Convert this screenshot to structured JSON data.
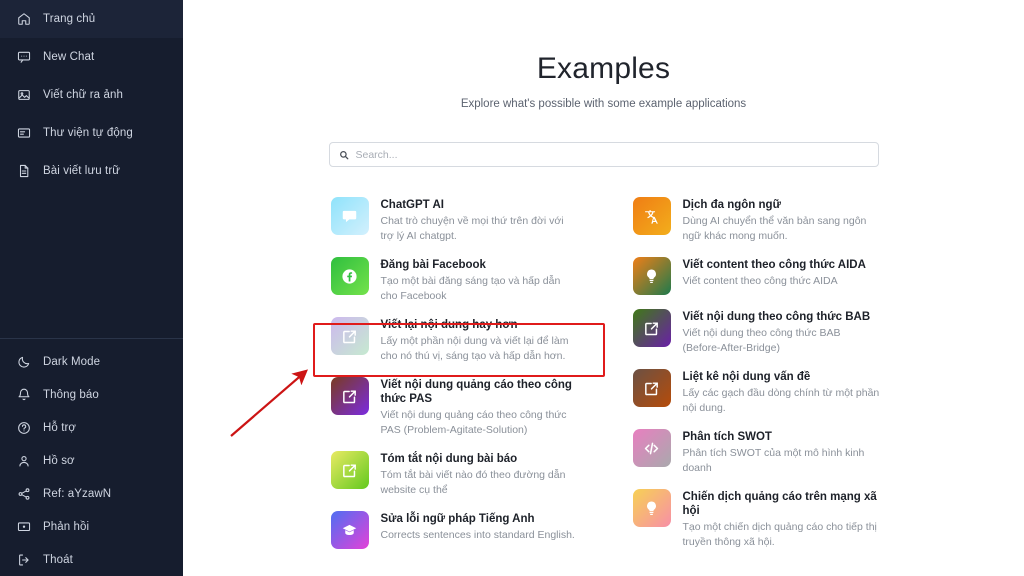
{
  "sidebar": {
    "top_items": [
      {
        "label": "Trang chủ",
        "icon": "home-icon",
        "active": true
      },
      {
        "label": "New Chat",
        "icon": "chat-icon",
        "active": false
      },
      {
        "label": "Viết chữ ra ảnh",
        "icon": "image-icon",
        "active": false
      },
      {
        "label": "Thư viện tự động",
        "icon": "library-icon",
        "active": false
      },
      {
        "label": "Bài viết lưu trữ",
        "icon": "document-icon",
        "active": false
      }
    ],
    "bottom_items": [
      {
        "label": "Dark Mode",
        "icon": "moon-icon"
      },
      {
        "label": "Thông báo",
        "icon": "bell-icon"
      },
      {
        "label": "Hỗ trợ",
        "icon": "question-circle-icon"
      },
      {
        "label": "Hồ sơ",
        "icon": "user-icon"
      },
      {
        "label": "Ref: aYzawN",
        "icon": "share-icon"
      },
      {
        "label": "Phản hồi",
        "icon": "feedback-icon"
      },
      {
        "label": "Thoát",
        "icon": "logout-icon"
      }
    ],
    "background_color": "#161d2e",
    "active_color": "#1f2840"
  },
  "main": {
    "title": "Examples",
    "subtitle": "Explore what's possible with some example applications",
    "search": {
      "placeholder": "Search...",
      "value": "",
      "icon": "search-icon"
    }
  },
  "cards": {
    "left": [
      {
        "title": "ChatGPT AI",
        "desc": "Chat trò chuyện về mọi thứ trên đời với trợ lý AI chatgpt.",
        "icon": "chat-bubble-icon",
        "gradient_from": "#8fe3fb",
        "gradient_to": "#c9ecfb"
      },
      {
        "title": "Đăng bài Facebook",
        "desc": "Tạo một bài đăng sáng tạo và hấp dẫn cho Facebook",
        "icon": "facebook-icon",
        "gradient_from": "#2fbf3f",
        "gradient_to": "#63dd46"
      },
      {
        "title": "Viết lại nội dung hay hơn",
        "desc": "Lấy một phần nội dung và viết lại để làm cho nó thú vị, sáng tạo và hấp dẫn hơn.",
        "icon": "edit-square-icon",
        "gradient_from": "#cdb8ee",
        "gradient_to": "#bfe8cd",
        "highlighted": true
      },
      {
        "title": "Viết nội dung quảng cáo theo công thức PAS",
        "desc": "Viết nội dung quảng cáo theo công thức PAS (Problem-Agitate-Solution)",
        "icon": "edit-square-icon",
        "gradient_from": "#7a3b21",
        "gradient_to": "#7b2ce0"
      },
      {
        "title": "Tóm tắt nội dung bài báo",
        "desc": "Tóm tắt bài viết nào đó theo đường dẫn website cụ thể",
        "icon": "edit-square-icon",
        "gradient_from": "#e9ea63",
        "gradient_to": "#63c91f"
      },
      {
        "title": "Sửa lỗi ngữ pháp Tiếng Anh",
        "desc": "Corrects sentences into standard English.",
        "icon": "graduation-cap-icon",
        "gradient_from": "#4f6ff2",
        "gradient_to": "#e341d8"
      }
    ],
    "right": [
      {
        "title": "Dịch đa ngôn ngữ",
        "desc": "Dùng AI chuyển thể văn bản sang ngôn ngữ khác mong muốn.",
        "icon": "translate-icon",
        "gradient_from": "#f07d14",
        "gradient_to": "#f2a81a"
      },
      {
        "title": "Viết content theo công thức AIDA",
        "desc": "Viết content theo công thức AIDA",
        "icon": "lightbulb-icon",
        "gradient_from": "#ef7f18",
        "gradient_to": "#1f7a4c"
      },
      {
        "title": "Viết nội dung theo công thức BAB",
        "desc": "Viết nội dung theo công thức BAB (Before-After-Bridge)",
        "icon": "edit-square-icon",
        "gradient_from": "#3f7a16",
        "gradient_to": "#6a1fa8"
      },
      {
        "title": "Liệt kê nội dung vấn đề",
        "desc": "Lấy các gạch đầu dòng chính từ một phần nội dung.",
        "icon": "edit-square-icon",
        "gradient_from": "#6b5144",
        "gradient_to": "#b64c0a"
      },
      {
        "title": "Phân tích SWOT",
        "desc": "Phân tích SWOT của một mô hình kinh doanh",
        "icon": "code-icon",
        "gradient_from": "#e87fc0",
        "gradient_to": "#a9a9ad"
      },
      {
        "title": "Chiến dịch quảng cáo trên mạng xã hội",
        "desc": "Tạo một chiến dịch quảng cáo cho tiếp thị truyền thông xã hội.",
        "icon": "lightbulb-icon",
        "gradient_from": "#f7d154",
        "gradient_to": "#f78fa7"
      }
    ]
  },
  "annotations": {
    "highlight_color": "#e01b1b",
    "arrow_color": "#cc1414",
    "highlight_target": "Viết lại nội dung hay hơn"
  }
}
